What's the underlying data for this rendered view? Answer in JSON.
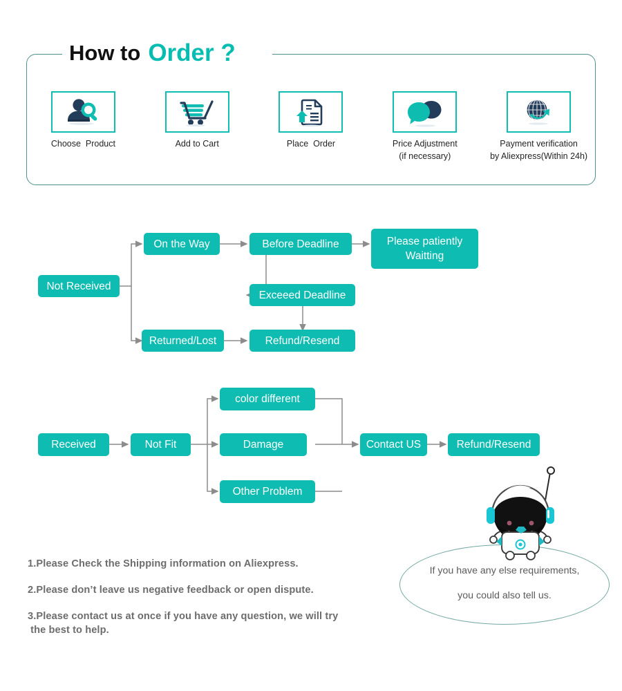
{
  "header": {
    "title_black": "How to",
    "title_accent": "Order ?",
    "frame_color": "#4d918c"
  },
  "colors": {
    "teal": "#0fbcb1",
    "teal_accent": "#07bdb2",
    "navy": "#233c5a",
    "note_gray": "#6d6d6d",
    "bubble_border": "#74a9a4",
    "connector": "#8c8c8c"
  },
  "steps": [
    {
      "label": "Choose  Product",
      "icon": "person-search-icon"
    },
    {
      "label": "Add to Cart",
      "icon": "shopping-cart-icon"
    },
    {
      "label": "Place  Order",
      "icon": "document-upload-icon"
    },
    {
      "label": "Price Adjustment\n(if necessary)",
      "icon": "chat-bubbles-icon"
    },
    {
      "label": "Payment verification\nby Aliexpress(Within 24h)",
      "icon": "globe-arrow-icon"
    }
  ],
  "flow_not_received": {
    "nodes": {
      "not_received": "Not Received",
      "on_the_way": "On the Way",
      "before_deadline": "Before Deadline",
      "please_waiting": "Please patiently\nWaitting",
      "exceed_deadline": "Exceeed Deadline",
      "returned_lost": "Returned/Lost",
      "refund_resend": "Refund/Resend"
    }
  },
  "flow_received": {
    "nodes": {
      "received": "Received",
      "not_fit": "Not Fit",
      "color_different": "color different",
      "damage": "Damage",
      "other_problem": "Other Problem",
      "contact_us": "Contact US",
      "refund_resend": "Refund/Resend"
    }
  },
  "notes": [
    "1.Please Check the Shipping information on Aliexpress.",
    "2.Please don’t leave us negative feedback or open dispute.",
    "3.Please contact us at once if you have any question, we will try\n the best to help."
  ],
  "bubble": {
    "text": "If you have any else requirements,\nyou could also tell us."
  }
}
